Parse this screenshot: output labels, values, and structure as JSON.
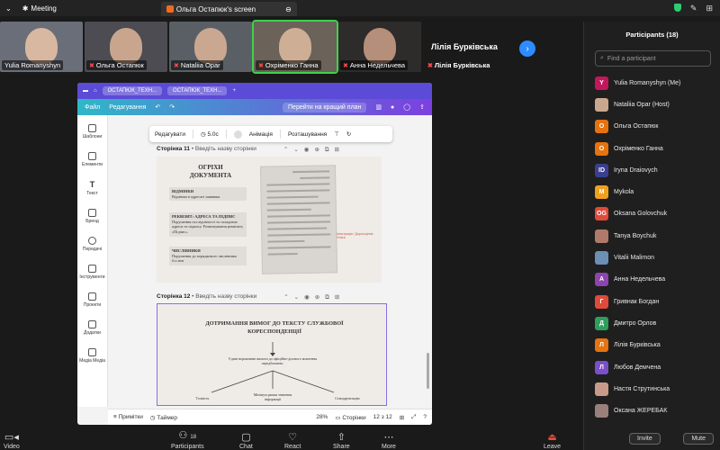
{
  "topbar": {
    "meeting_label": "Meeting",
    "share_tab_label": "Ольга Остапюк's screen"
  },
  "gallery": {
    "tiles": [
      {
        "name": "Yulia Romanyshyn",
        "muted": false
      },
      {
        "name": "Ольга Остапюк",
        "muted": true
      },
      {
        "name": "Nataliia Opar",
        "muted": true
      },
      {
        "name": "Охріменко Ганна",
        "muted": true
      },
      {
        "name": "Анна Недельчева",
        "muted": true
      },
      {
        "name": "Лілія Бурківська",
        "muted": true
      }
    ],
    "text_tile_name": "Лілія Бурківська"
  },
  "canva": {
    "tab1": "ОСТАПЮК_ТЕХН...",
    "tab2": "ОСТАПЮК_ТЕХН...",
    "menu_file": "Файл",
    "menu_edit": "Редагування",
    "upgrade": "Перейти на кращий план",
    "float_edit": "Редагувати",
    "float_time": "5.0с",
    "float_anim": "Анімація",
    "float_position": "Розташування",
    "sidebar": [
      "Шаблони",
      "Елементи",
      "Текст",
      "Бренд",
      "Передачі",
      "Інструменти",
      "Проекти",
      "Додатки",
      "Медіа Медіа"
    ],
    "page11_label": "Сторінка 11",
    "page12_label": "Сторінка 12",
    "page_title_placeholder": "Введіть назву сторінки",
    "page11": {
      "title": "ОГРІХИ ДОКУМЕНТА",
      "box1_title": "ВІДМІНКИ",
      "box1_text": "Відмінки в адресаті заявника",
      "box2_title": "РЕКВІЗИТ: АДРЕСА ТА ПІДПИС",
      "box2_text": "Порушення послідовності та складових адреси та підпису. Розмежування реквізиту «Підпис».",
      "box3_title": "ЧИСЛІВНИКИ",
      "box3_text": "Порушення до порядкового числівника б.п.нов",
      "red_note": "Ілюстрація / Дорогоцінна Ольга"
    },
    "page12": {
      "title": "ДОТРИМАННЯ ВИМОГ ДО ТЕКСТУ СЛУЖБОВОЇ КОРЕСПОНДЕНЦІЇ",
      "center_text": "Єдині нормативні вимоги до офіційно-ділового мовлення передбачають:",
      "left_text": "Точність",
      "mid_text": "Мінімум рамки значення інформації",
      "right_text": "Стандартизацію"
    },
    "bottom_notes": "Примітки",
    "bottom_timer": "Таймер",
    "bottom_zoom": "28%",
    "bottom_pages": "Сторінки",
    "bottom_count": "12 з 12"
  },
  "participants": {
    "header": "Participants (18)",
    "search_placeholder": "Find a participant",
    "list": [
      {
        "initial": "Y",
        "color": "#c2185b",
        "name": "Yulia Romanyshyn (Me)"
      },
      {
        "initial": "",
        "color": "#caa78f",
        "name": "Nataliia Opar (Host)"
      },
      {
        "initial": "O",
        "color": "#e6730f",
        "name": "Ольга Остапюк"
      },
      {
        "initial": "O",
        "color": "#e6730f",
        "name": "Охріменко Ганна"
      },
      {
        "initial": "ID",
        "color": "#3b3f8f",
        "name": "Iryna Draiovych"
      },
      {
        "initial": "M",
        "color": "#f0a020",
        "name": "Mykola"
      },
      {
        "initial": "OG",
        "color": "#e04a3a",
        "name": "Oksana Golovchuk"
      },
      {
        "initial": "",
        "color": "#b07a6a",
        "name": "Tanya Boychuk"
      },
      {
        "initial": "",
        "color": "#6b8fb5",
        "name": "Vitalii Malimon"
      },
      {
        "initial": "A",
        "color": "#8e44ad",
        "name": "Анна Недельчева"
      },
      {
        "initial": "Г",
        "color": "#e04a3a",
        "name": "Гривнак Богдан"
      },
      {
        "initial": "Д",
        "color": "#2e9e5e",
        "name": "Дмитро Орлов"
      },
      {
        "initial": "Л",
        "color": "#e6730f",
        "name": "Лілія Бурківська"
      },
      {
        "initial": "Л",
        "color": "#7b4fc9",
        "name": "Любов Демчена"
      },
      {
        "initial": "",
        "color": "#c99a8a",
        "name": "Настя Струтинська"
      },
      {
        "initial": "",
        "color": "#9a7f7a",
        "name": "Оксана ЖЕРЕБАК"
      }
    ],
    "invite": "Invite",
    "mute": "Mute"
  },
  "bottombar": {
    "video": "Video",
    "participants": "Participants",
    "participants_count": "18",
    "chat": "Chat",
    "react": "React",
    "share": "Share",
    "more": "More",
    "leave": "Leave"
  }
}
